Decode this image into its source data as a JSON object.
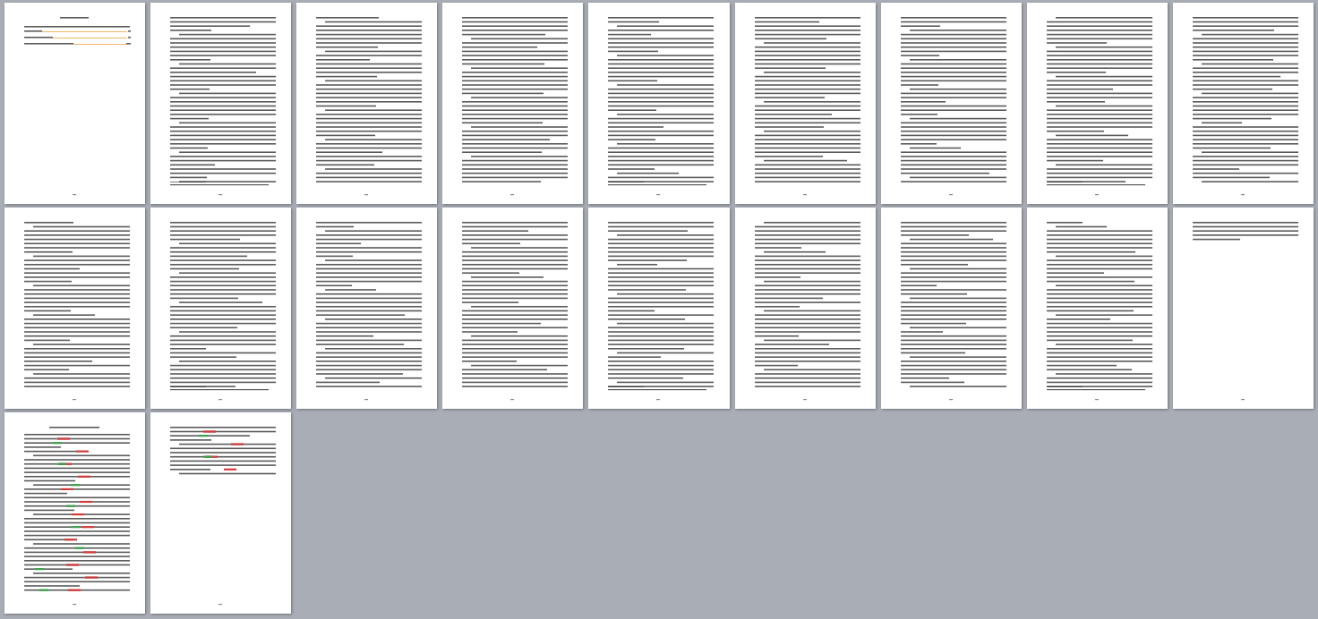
{
  "pages": [
    {
      "kind": "toc"
    },
    {
      "kind": "full"
    },
    {
      "kind": "full"
    },
    {
      "kind": "full"
    },
    {
      "kind": "full"
    },
    {
      "kind": "full"
    },
    {
      "kind": "full"
    },
    {
      "kind": "full"
    },
    {
      "kind": "full"
    },
    {
      "kind": "full"
    },
    {
      "kind": "full"
    },
    {
      "kind": "full"
    },
    {
      "kind": "full"
    },
    {
      "kind": "full"
    },
    {
      "kind": "full"
    },
    {
      "kind": "full"
    },
    {
      "kind": "full"
    },
    {
      "kind": "short"
    },
    {
      "kind": "references"
    },
    {
      "kind": "references-short"
    }
  ]
}
